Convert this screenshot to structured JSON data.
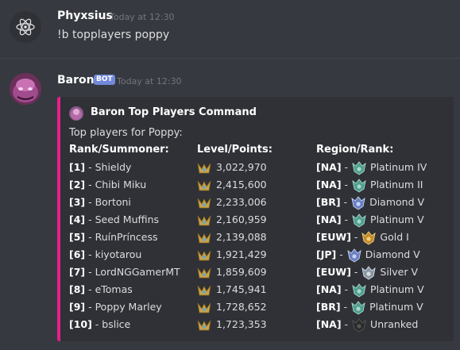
{
  "messages": [
    {
      "author": "Phyxsius",
      "timestamp": "Today at 12:30",
      "text": "!b topplayers poppy"
    },
    {
      "author": "Baron",
      "badge": "BOT",
      "timestamp": "Today at 12:30"
    }
  ],
  "embed": {
    "accent": "#e91e8c",
    "author": "Baron Top Players Command",
    "description": "Top players for Poppy:",
    "columns": [
      "Rank/Summoner:",
      "Level/Points:",
      "Region/Rank:"
    ],
    "rows": [
      {
        "rank": "[1]",
        "summoner": " - Shieldy",
        "points": "3,022,970",
        "region": "[NA]",
        "tier": "Platinum IV",
        "icon": "platinum"
      },
      {
        "rank": "[2]",
        "summoner": " - Chibi Miku",
        "points": "2,415,600",
        "region": "[NA]",
        "tier": "Platinum II",
        "icon": "platinum"
      },
      {
        "rank": "[3]",
        "summoner": " - Bortoni",
        "points": "2,233,006",
        "region": "[BR]",
        "tier": "Diamond V",
        "icon": "diamond"
      },
      {
        "rank": "[4]",
        "summoner": " - Seed Muffins",
        "points": "2,160,959",
        "region": "[NA]",
        "tier": "Platinum V",
        "icon": "platinum"
      },
      {
        "rank": "[5]",
        "summoner": " - RuínPríncess",
        "points": "2,139,088",
        "region": "[EUW]",
        "tier": "Gold I",
        "icon": "gold"
      },
      {
        "rank": "[6]",
        "summoner": " - kiyotarou",
        "points": "1,921,429",
        "region": "[JP]",
        "tier": "Diamond V",
        "icon": "diamond"
      },
      {
        "rank": "[7]",
        "summoner": " - LordNGGamerMT",
        "points": "1,859,609",
        "region": "[EUW]",
        "tier": "Silver V",
        "icon": "silver"
      },
      {
        "rank": "[8]",
        "summoner": " - eTomas",
        "points": "1,745,941",
        "region": "[NA]",
        "tier": "Platinum V",
        "icon": "platinum"
      },
      {
        "rank": "[9]",
        "summoner": " - Poppy Marley",
        "points": "1,728,652",
        "region": "[BR]",
        "tier": "Platinum V",
        "icon": "platinum"
      },
      {
        "rank": "[10]",
        "summoner": " - bslice",
        "points": "1,723,353",
        "region": "[NA]",
        "tier": "Unranked",
        "icon": "unranked"
      }
    ]
  }
}
